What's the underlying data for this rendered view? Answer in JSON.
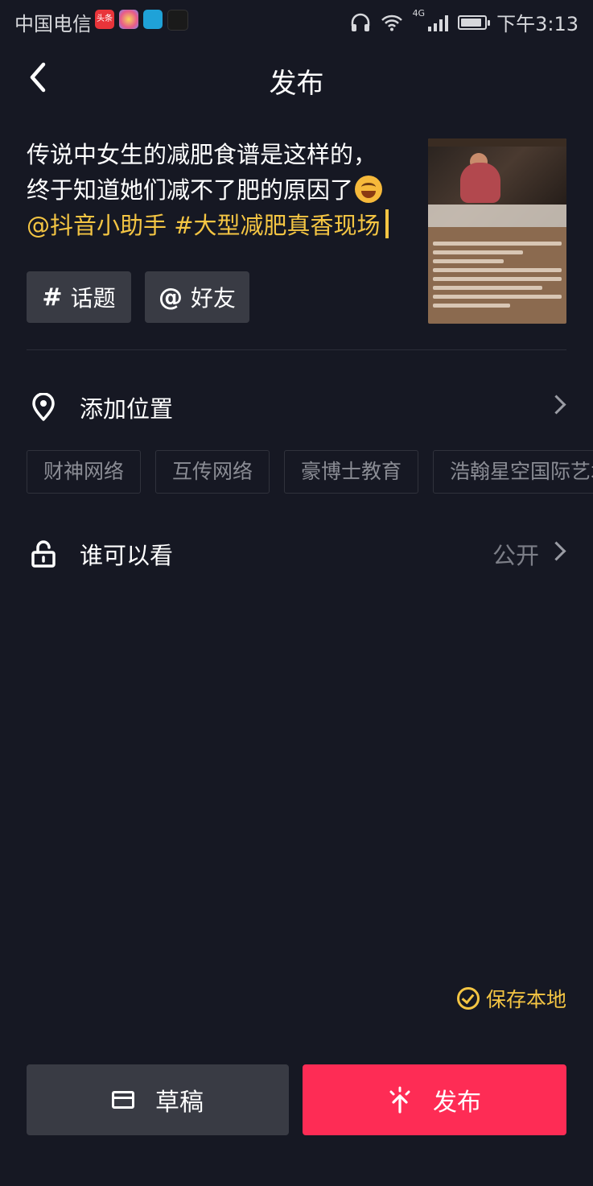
{
  "status_bar": {
    "carrier": "中国电信",
    "badges": [
      {
        "name": "toutiao-app-icon",
        "text": "头条",
        "color": "#e8343a"
      },
      {
        "name": "app-icon-colorful",
        "text": "",
        "color": "#7b8cf0"
      },
      {
        "name": "book-app-icon",
        "text": "",
        "color": "#1fa2d8"
      },
      {
        "name": "circle-app-icon",
        "text": "",
        "color": "#1a1a1a"
      }
    ],
    "network": "4G",
    "battery_level": 0.9,
    "time": "下午3:13"
  },
  "nav": {
    "title": "发布"
  },
  "caption": {
    "line1": "传说中女生的减肥食谱是这样的，",
    "line2": "终于知道她们减不了肥的原因了",
    "mention": "@抖音小助手",
    "hashtag": "#大型减肥真香现场"
  },
  "tags": {
    "topic_label": "话题",
    "topic_symbol": "#",
    "friend_label": "好友",
    "friend_symbol": "@"
  },
  "location": {
    "label": "添加位置",
    "suggestions": [
      "财神网络",
      "互传网络",
      "豪博士教育",
      "浩翰星空国际艺术"
    ]
  },
  "privacy": {
    "label": "谁可以看",
    "value": "公开"
  },
  "save_local": {
    "label": "保存本地"
  },
  "actions": {
    "draft_label": "草稿",
    "publish_label": "发布"
  },
  "colors": {
    "accent": "#fe2c55",
    "highlight": "#f4c543",
    "background": "#161823"
  }
}
